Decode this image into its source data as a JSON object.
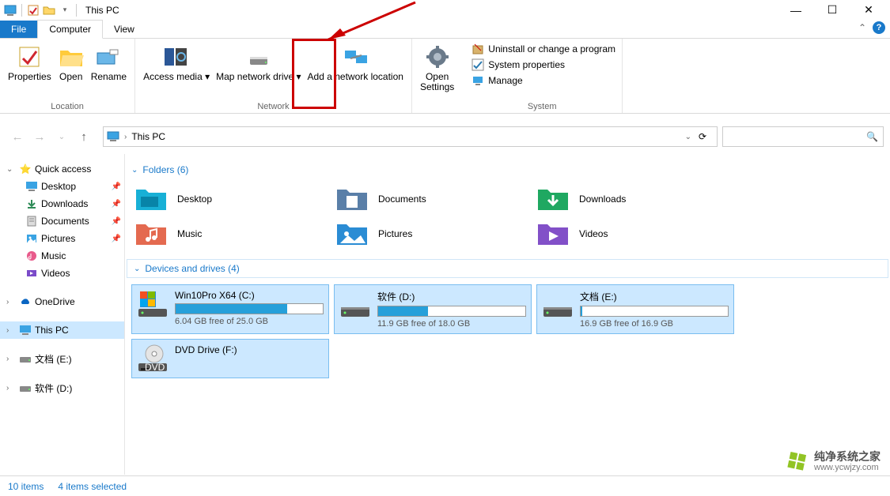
{
  "window": {
    "title": "This PC"
  },
  "ribbon_tabs": {
    "file": "File",
    "computer": "Computer",
    "view": "View"
  },
  "ribbon": {
    "location": {
      "properties": "Properties",
      "open": "Open",
      "rename": "Rename",
      "group": "Location"
    },
    "network": {
      "access_media": "Access media",
      "map_drive": "Map network drive",
      "add_location": "Add a network location",
      "group": "Network"
    },
    "open_settings_l1": "Open",
    "open_settings_l2": "Settings",
    "system": {
      "uninstall": "Uninstall or change a program",
      "sys_props": "System properties",
      "manage": "Manage",
      "group": "System"
    }
  },
  "address": {
    "location": "This PC"
  },
  "search": {
    "placeholder": ""
  },
  "sidebar": {
    "quick_access": "Quick access",
    "desktop": "Desktop",
    "downloads": "Downloads",
    "documents": "Documents",
    "pictures": "Pictures",
    "music": "Music",
    "videos": "Videos",
    "onedrive": "OneDrive",
    "this_pc": "This PC",
    "drive_e": "文档 (E:)",
    "drive_d": "软件 (D:)"
  },
  "sections": {
    "folders": "Folders (6)",
    "drives": "Devices and drives (4)"
  },
  "folders": {
    "desktop": "Desktop",
    "documents": "Documents",
    "downloads": "Downloads",
    "music": "Music",
    "pictures": "Pictures",
    "videos": "Videos"
  },
  "drives": {
    "c": {
      "name": "Win10Pro X64 (C:)",
      "free": "6.04 GB free of 25.0 GB",
      "pct_used": 76
    },
    "d": {
      "name": "软件 (D:)",
      "free": "11.9 GB free of 18.0 GB",
      "pct_used": 34
    },
    "e": {
      "name": "文档 (E:)",
      "free": "16.9 GB free of 16.9 GB",
      "pct_used": 1
    },
    "f": {
      "name": "DVD Drive (F:)"
    }
  },
  "status": {
    "items": "10 items",
    "selected": "4 items selected"
  },
  "watermark": {
    "line1": "纯净系统之家",
    "line2": "www.ycwjzy.com"
  }
}
